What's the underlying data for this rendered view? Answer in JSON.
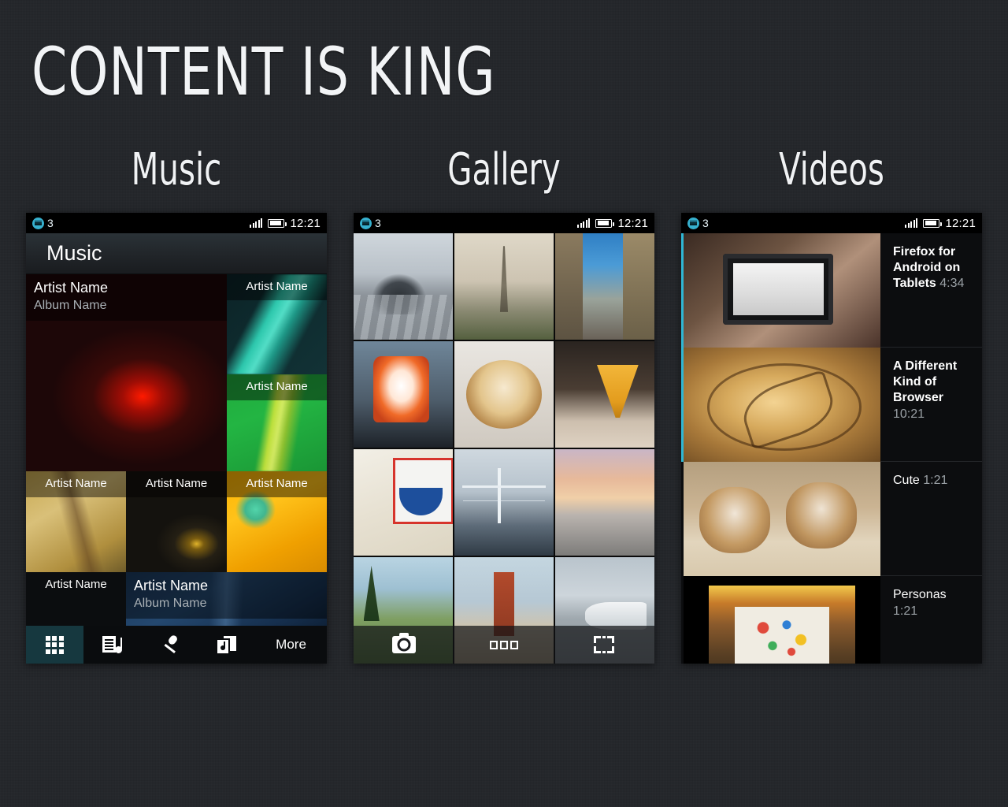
{
  "page": {
    "title": "CONTENT IS KING",
    "background_color": "#23262a"
  },
  "sections": [
    {
      "caption": "Music"
    },
    {
      "caption": "Gallery"
    },
    {
      "caption": "Videos"
    }
  ],
  "statusbar": {
    "notification_count": "3",
    "time": "12:21",
    "notification_icon": "notifications-icon",
    "signal_icon": "signal-bars-icon",
    "battery_icon": "battery-icon"
  },
  "music": {
    "app_title": "Music",
    "tiles": [
      {
        "artist": "Artist Name",
        "album": "Album Name",
        "art": "art-red"
      },
      {
        "artist": "Artist Name",
        "album": "",
        "art": "art-teal"
      },
      {
        "artist": "Artist Name",
        "album": "",
        "art": "art-green"
      },
      {
        "artist": "Artist Name",
        "album": "",
        "art": "art-sand"
      },
      {
        "artist": "Artist Name",
        "album": "",
        "art": "art-dark"
      },
      {
        "artist": "Artist Name",
        "album": "",
        "art": "art-orange"
      },
      {
        "artist": "Artist Name",
        "album": "",
        "art": "none"
      },
      {
        "artist": "Artist Name",
        "album": "Album Name",
        "art": "art-blue"
      }
    ],
    "tabs": [
      {
        "label": "",
        "icon": "albums-grid-icon",
        "active": true
      },
      {
        "label": "",
        "icon": "playlist-icon",
        "active": false
      },
      {
        "label": "",
        "icon": "microphone-icon",
        "active": false
      },
      {
        "label": "",
        "icon": "songs-icon",
        "active": false
      },
      {
        "label": "More",
        "icon": "more-label",
        "active": false
      }
    ]
  },
  "gallery": {
    "photos": [
      {
        "alt": "paris-street-vintage-car",
        "style": "ph-street"
      },
      {
        "alt": "eiffel-tower",
        "style": "ph-eiffel"
      },
      {
        "alt": "haussmann-buildings",
        "style": "ph-haussmann"
      },
      {
        "alt": "foxkeh-papercraft-toy",
        "style": "ph-foxy"
      },
      {
        "alt": "meringue-pie-dessert",
        "style": "ph-pie"
      },
      {
        "alt": "cocktail-with-cherry",
        "style": "ph-cocktail"
      },
      {
        "alt": "i-like-eich-poster",
        "style": "ph-eich"
      },
      {
        "alt": "bay-bridge-san-francisco",
        "style": "ph-bridge"
      },
      {
        "alt": "beach-sunset",
        "style": "ph-sunset"
      },
      {
        "alt": "lakeside-park-lawn",
        "style": "ph-park"
      },
      {
        "alt": "rusty-tower-beach",
        "style": "ph-tower"
      },
      {
        "alt": "airport-airplane-gate",
        "style": "ph-airport"
      }
    ],
    "toolbar": [
      {
        "icon": "camera-icon"
      },
      {
        "icon": "gallery-view-icon"
      },
      {
        "icon": "select-crop-icon"
      }
    ]
  },
  "videos": {
    "items": [
      {
        "title": "Firefox for Android on Tablets",
        "duration": "4:34",
        "bold": true,
        "inline_duration": true,
        "accent": true,
        "thumb": "th-tablet",
        "letterbox": false
      },
      {
        "title": "A Different Kind of Browser",
        "duration": "10:21",
        "bold": true,
        "inline_duration": false,
        "accent": true,
        "thumb": "th-crop",
        "letterbox": false
      },
      {
        "title": "Cute",
        "duration": "1:21",
        "bold": false,
        "inline_duration": true,
        "accent": false,
        "thumb": "th-panda",
        "letterbox": false
      },
      {
        "title": "Personas",
        "duration": "1:21",
        "bold": false,
        "inline_duration": false,
        "accent": false,
        "thumb": "th-personas",
        "letterbox": true
      }
    ]
  }
}
